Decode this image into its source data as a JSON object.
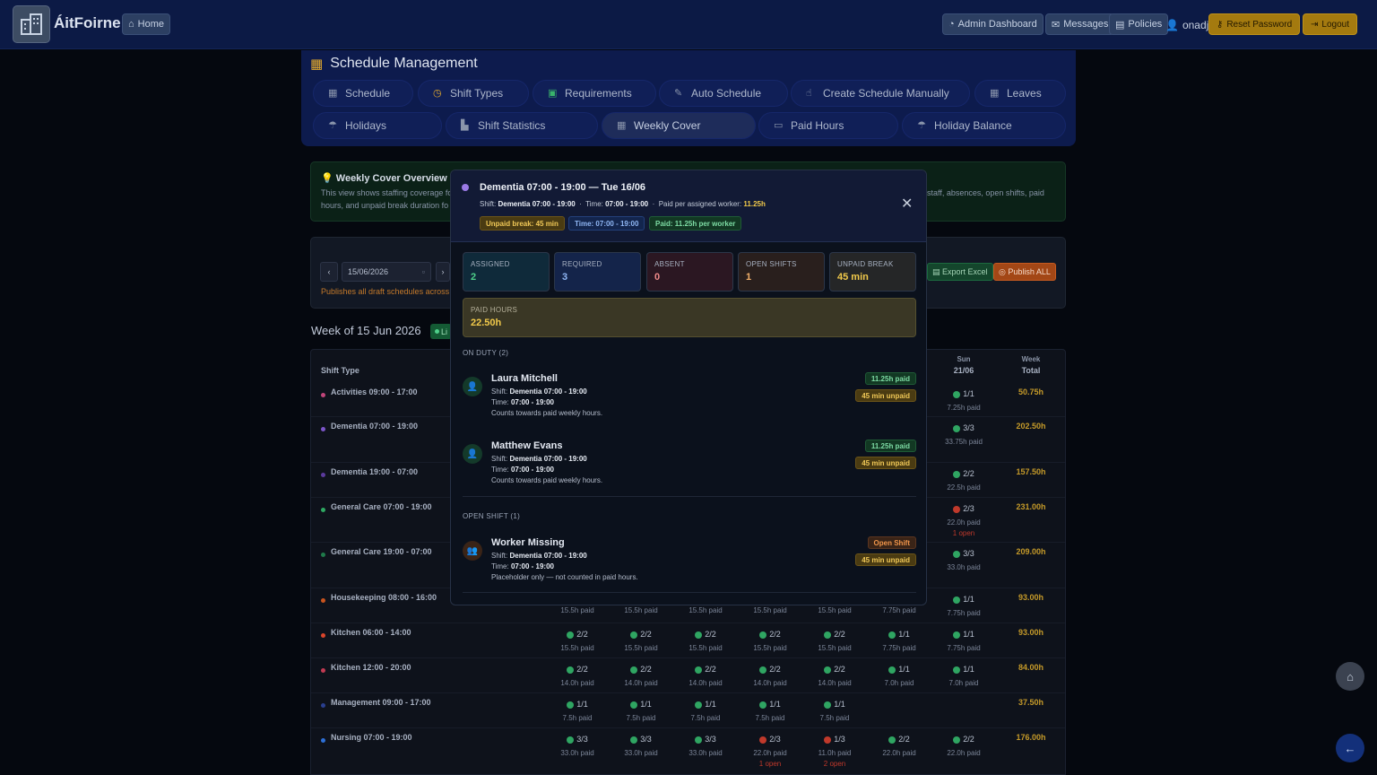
{
  "nav": {
    "brand": "ÁitFoirne",
    "home": "Home",
    "admin": "Admin Dashboard",
    "messages": "Messages",
    "policies": "Policies",
    "user": "onadj",
    "reset": "Reset Password",
    "logout": "Logout"
  },
  "schedule": {
    "title": "Schedule Management",
    "tabs": [
      {
        "label": "Schedule",
        "icon": "calendar-icon"
      },
      {
        "label": "Shift Types",
        "icon": "clock-icon"
      },
      {
        "label": "Requirements",
        "icon": "clipboard-icon"
      },
      {
        "label": "Auto Schedule",
        "icon": "wand-icon"
      },
      {
        "label": "Create Schedule Manually",
        "icon": "hand-icon"
      },
      {
        "label": "Leaves",
        "icon": "calendar-minus-icon"
      },
      {
        "label": "Holidays",
        "icon": "umbrella-icon"
      },
      {
        "label": "Shift Statistics",
        "icon": "chart-icon"
      },
      {
        "label": "Weekly Cover",
        "icon": "table-icon"
      },
      {
        "label": "Paid Hours",
        "icon": "money-icon"
      },
      {
        "label": "Holiday Balance",
        "icon": "umbrella-icon"
      }
    ]
  },
  "overview": {
    "title": "Weekly Cover Overview",
    "text_left_1": "This view shows staffing coverage fo",
    "text_left_2": "hours, and unpaid break duration fo",
    "text_right": "staff, absences, open shifts, paid"
  },
  "toolbar": {
    "date": "15/06/2026",
    "publish_note": "Publishes all draft schedules across",
    "export": "Export Excel",
    "publish_all": "Publish ALL"
  },
  "week": {
    "label": "Week of 15 Jun 2026",
    "badge": "Li"
  },
  "table": {
    "col_shift": "Shift Type",
    "col_sun": "Sun",
    "col_sun_date": "21/06",
    "col_week": "Week",
    "col_total": "Total",
    "rows": [
      {
        "name": "Activities 09:00 - 17:00",
        "color": "#c0457a",
        "sun": {
          "cov": "1/1",
          "paid": "7.25h paid",
          "ok": true
        },
        "total": "50.75h"
      },
      {
        "name": "Dementia 07:00 - 19:00",
        "color": "#7b55c8",
        "sun": {
          "cov": "3/3",
          "paid": "33.75h paid",
          "ok": true
        },
        "total": "202.50h"
      },
      {
        "name": "Dementia 19:00 - 07:00",
        "color": "#5b3a9c",
        "sun": {
          "cov": "2/2",
          "paid": "22.5h paid",
          "ok": true
        },
        "total": "157.50h"
      },
      {
        "name": "General Care 07:00 - 19:00",
        "color": "#2ea862",
        "sun": {
          "cov": "2/3",
          "paid": "22.0h paid",
          "open": "1 open",
          "ok": false
        },
        "total": "231.00h"
      },
      {
        "name": "General Care 19:00 - 07:00",
        "color": "#1f7a4a",
        "sun": {
          "cov": "3/3",
          "paid": "33.0h paid",
          "ok": true
        },
        "total": "209.00h"
      },
      {
        "name": "Housekeeping 08:00 - 16:00",
        "color": "#c9541e",
        "sun": {
          "cov": "1/1",
          "paid": "7.75h paid",
          "ok": true
        },
        "total": "93.00h"
      },
      {
        "name": "Kitchen 06:00 - 14:00",
        "color": "#d9452b",
        "sun": {
          "cov": "1/1",
          "paid": "7.75h paid",
          "ok": true
        },
        "total": "93.00h"
      },
      {
        "name": "Kitchen 12:00 - 20:00",
        "color": "#c23a52",
        "sun": {
          "cov": "1/1",
          "paid": "7.0h paid",
          "ok": true
        },
        "total": "84.00h"
      },
      {
        "name": "Management 09:00 - 17:00",
        "color": "#2a3f8f",
        "sun": null,
        "total": "37.50h"
      },
      {
        "name": "Nursing 07:00 - 19:00",
        "color": "#2d6fd6",
        "sun": {
          "cov": "2/2",
          "paid": "22.0h paid",
          "ok": true
        },
        "total": "176.00h"
      }
    ],
    "day_cells": [
      {
        "row": 5,
        "cells": [
          {
            "paid": "15.5h paid"
          },
          {
            "paid": "15.5h paid"
          },
          {
            "paid": "15.5h paid"
          },
          {
            "paid": "15.5h paid"
          },
          {
            "paid": "15.5h paid"
          },
          {
            "paid": "7.75h paid"
          }
        ]
      },
      {
        "row": 6,
        "cells": [
          {
            "cov": "2/2",
            "paid": "15.5h paid",
            "ok": true
          },
          {
            "cov": "2/2",
            "paid": "15.5h paid",
            "ok": true
          },
          {
            "cov": "2/2",
            "paid": "15.5h paid",
            "ok": true
          },
          {
            "cov": "2/2",
            "paid": "15.5h paid",
            "ok": true
          },
          {
            "cov": "2/2",
            "paid": "15.5h paid",
            "ok": true
          },
          {
            "cov": "1/1",
            "paid": "7.75h paid",
            "ok": true
          }
        ]
      },
      {
        "row": 7,
        "cells": [
          {
            "cov": "2/2",
            "paid": "14.0h paid",
            "ok": true
          },
          {
            "cov": "2/2",
            "paid": "14.0h paid",
            "ok": true
          },
          {
            "cov": "2/2",
            "paid": "14.0h paid",
            "ok": true
          },
          {
            "cov": "2/2",
            "paid": "14.0h paid",
            "ok": true
          },
          {
            "cov": "2/2",
            "paid": "14.0h paid",
            "ok": true
          },
          {
            "cov": "1/1",
            "paid": "7.0h paid",
            "ok": true
          }
        ]
      },
      {
        "row": 8,
        "cells": [
          {
            "cov": "1/1",
            "paid": "7.5h paid",
            "ok": true
          },
          {
            "cov": "1/1",
            "paid": "7.5h paid",
            "ok": true
          },
          {
            "cov": "1/1",
            "paid": "7.5h paid",
            "ok": true
          },
          {
            "cov": "1/1",
            "paid": "7.5h paid",
            "ok": true
          },
          {
            "cov": "1/1",
            "paid": "7.5h paid",
            "ok": true
          },
          null
        ]
      },
      {
        "row": 9,
        "cells": [
          {
            "cov": "3/3",
            "paid": "33.0h paid",
            "ok": true
          },
          {
            "cov": "3/3",
            "paid": "33.0h paid",
            "ok": true
          },
          {
            "cov": "3/3",
            "paid": "33.0h paid",
            "ok": true
          },
          {
            "cov": "2/3",
            "paid": "22.0h paid",
            "open": "1 open",
            "ok": false
          },
          {
            "cov": "1/3",
            "paid": "11.0h paid",
            "open": "2 open",
            "ok": false
          },
          {
            "cov": "2/2",
            "paid": "22.0h paid",
            "ok": true
          }
        ]
      }
    ]
  },
  "modal": {
    "title": "Dementia 07:00 - 19:00 — Tue 16/06",
    "shift_label": "Shift:",
    "shift_value": "Dementia 07:00 - 19:00",
    "time_label": "Time:",
    "time_value": "07:00 - 19:00",
    "paid_label": "Paid per assigned worker:",
    "paid_value": "11.25h",
    "pill_break": "Unpaid break: 45 min",
    "pill_time": "Time: 07:00 - 19:00",
    "pill_paid": "Paid: 11.25h per worker",
    "stats": [
      {
        "label": "ASSIGNED",
        "value": "2",
        "color": "#4fd08a"
      },
      {
        "label": "REQUIRED",
        "value": "3",
        "color": "#8fb6f4"
      },
      {
        "label": "ABSENT",
        "value": "0",
        "color": "#f08a8a"
      },
      {
        "label": "OPEN SHIFTS",
        "value": "1",
        "color": "#f3b06a"
      },
      {
        "label": "UNPAID BREAK",
        "value": "45 min",
        "color": "#f1c94a"
      }
    ],
    "paid_hours_label": "PAID HOURS",
    "paid_hours_value": "22.50h",
    "on_duty_label": "ON DUTY (2)",
    "workers": [
      {
        "name": "Laura Mitchell",
        "shift": "Dementia 07:00 - 19:00",
        "time": "07:00 - 19:00",
        "note": "Counts towards paid weekly hours.",
        "paid_tag": "11.25h paid",
        "unpaid_tag": "45 min unpaid"
      },
      {
        "name": "Matthew Evans",
        "shift": "Dementia 07:00 - 19:00",
        "time": "07:00 - 19:00",
        "note": "Counts towards paid weekly hours.",
        "paid_tag": "11.25h paid",
        "unpaid_tag": "45 min unpaid"
      }
    ],
    "open_label": "OPEN SHIFT (1)",
    "open_worker": {
      "name": "Worker Missing",
      "shift": "Dementia 07:00 - 19:00",
      "time": "07:00 - 19:00",
      "note": "Placeholder only — not counted in paid hours.",
      "tag": "Open Shift",
      "unpaid_tag": "45 min unpaid"
    },
    "line_shift": "Shift:",
    "line_time": "Time:"
  }
}
